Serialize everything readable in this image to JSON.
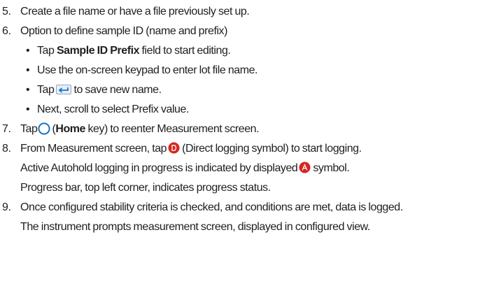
{
  "colors": {
    "text": "#1f1f1f",
    "accent_blue": "#1a73c8",
    "logging_red": "#d7261e"
  },
  "icons": {
    "enter": "enter-arrow-key-icon",
    "home": "home-circle-icon",
    "direct_logging": "direct-logging-d-icon",
    "autohold": "autohold-a-icon"
  },
  "step5": {
    "num": "5.",
    "text": "Create a file name or have a file previously set up."
  },
  "step6": {
    "num": "6.",
    "text": "Option to define sample ID (name and prefix)",
    "b1": {
      "bullet": "•",
      "pre": "Tap",
      "bold": "Sample ID Prefix",
      "post": "field to start editing."
    },
    "b2": {
      "bullet": "•",
      "text": "Use the on-screen keypad to enter lot file name."
    },
    "b3": {
      "bullet": "•",
      "pre": "Tap",
      "post": "to save new name."
    },
    "b4": {
      "bullet": "•",
      "text": "Next, scroll to select Prefix value."
    }
  },
  "step7": {
    "num": "7.",
    "pre": "Tap",
    "paren_open": "(",
    "bold": "Home",
    "post": "key) to reenter Measurement screen."
  },
  "step8": {
    "num": "8.",
    "line1_pre": "From Measurement screen, tap",
    "line1_post": "(Direct logging symbol) to start logging.",
    "line2_pre": "Active Autohold logging in progress is indicated by displayed",
    "line2_post": "symbol.",
    "line3": "Progress bar, top left corner, indicates progress status."
  },
  "step9": {
    "num": "9.",
    "line1": "Once configured stability criteria is checked, and conditions are met, data is logged.",
    "line2": "The instrument prompts measurement screen, displayed in configured view."
  }
}
